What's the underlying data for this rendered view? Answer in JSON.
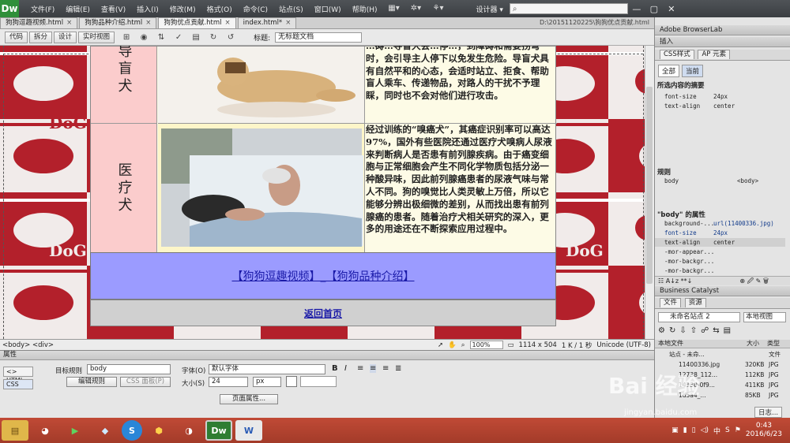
{
  "app": {
    "logo": "Dw",
    "designer_label": "设计器 ▾"
  },
  "menu": [
    "文件(F)",
    "编辑(E)",
    "查看(V)",
    "插入(I)",
    "修改(M)",
    "格式(O)",
    "命令(C)",
    "站点(S)",
    "窗口(W)",
    "帮助(H)"
  ],
  "tabs": [
    {
      "label": "狗狗逗趣视频.html",
      "active": false
    },
    {
      "label": "狗狗品种介绍.html",
      "active": false
    },
    {
      "label": "狗狗优点贡献.html",
      "active": true
    },
    {
      "label": "index.html*",
      "active": false
    }
  ],
  "doc_path": "D:\\20151120225\\狗狗优点贡献.html",
  "toolbar": {
    "code": "代码",
    "split": "拆分",
    "design": "设计",
    "live": "实时视图",
    "title_label": "标题:",
    "title_value": "无标题文档"
  },
  "page": {
    "row1": {
      "label": "导盲犬",
      "text": "…碍…导盲犬会…停…，到障碍和需要拐弯时，会引导主人停下以免发生危险。导盲犬具有自然平和的心态，会适时站立、拒食、帮助盲人乘车、传递物品，对路人的干扰不予理睬，同时也不会对他们进行攻击。"
    },
    "row2": {
      "label": "医疗犬",
      "text": "经过训练的“嗅癌犬”，其癌症识别率可以高达97%，国外有些医院还通过医疗犬嗅病人尿液来判断病人是否患有前列腺疾病。由于癌变细胞与正常细胞会产生不同化学物质包括分泌一种酸异味，因此前列腺癌患者的尿液气味与常人不同。狗的嗅觉比人类灵敏上万倍，所以它能够分辨出极细微的差别，从而找出患有前列腺癌的患者。随着治疗犬相关研究的深入，更多的用途还在不断探索应用过程中。"
    },
    "nav_links": "【狗狗逗趣视频】_【狗狗品种介绍】",
    "home_link": "返回首页",
    "pattern_text": "DoG"
  },
  "status": {
    "tags": "<body> <div>",
    "zoom": "100%",
    "size": "1114 x 504",
    "transfer": "1 K / 1 秒",
    "encoding": "Unicode (UTF-8)"
  },
  "props": {
    "header": "属性",
    "html_btn": "<> HTML",
    "css_btn": "CSS",
    "target_rule_label": "目标规则",
    "target_rule_value": "body",
    "edit_rule": "编辑规则",
    "css_panel": "CSS 面板(P)",
    "font_label": "字体(O)",
    "font_value": "默认字体",
    "size_label": "大小(S)",
    "size_value": "24",
    "unit_value": "px",
    "page_props": "页面属性..."
  },
  "panel": {
    "browserlab": "Adobe BrowserLab",
    "insert": "插入",
    "css_tab": "CSS样式",
    "ap_tab": "AP 元素",
    "all": "全部",
    "current": "当前",
    "summary_title": "所选内容的摘要",
    "summary": [
      {
        "k": "font-size",
        "v": "24px"
      },
      {
        "k": "text-align",
        "v": "center"
      }
    ],
    "rules_title": "规则",
    "rules": [
      {
        "k": "body",
        "v": "<body>"
      }
    ],
    "props_title": "\"body\" 的属性",
    "props": [
      {
        "k": "background-...",
        "v": "url(11400336.jpg)"
      },
      {
        "k": "font-size",
        "v": "24px"
      },
      {
        "k": "text-align",
        "v": "center"
      },
      {
        "k": "-mor-appear...",
        "v": ""
      },
      {
        "k": "-mor-backgr...",
        "v": ""
      },
      {
        "k": "-mor-backgr...",
        "v": ""
      }
    ],
    "bc_title": "Business Catalyst",
    "files_tab": "文件",
    "assets_tab": "资源",
    "site_select": "未命名站点 2",
    "view_select": "本地视图",
    "col_local": "本地文件",
    "col_size": "大小",
    "col_type": "类型",
    "files": [
      {
        "name": "站点 - 未命...",
        "size": "",
        "type": "文件"
      },
      {
        "name": "11400336.jpg",
        "size": "320KB",
        "type": "JPG"
      },
      {
        "name": "12738_112...",
        "size": "112KB",
        "type": "JPG"
      },
      {
        "name": "14130-0f9...",
        "size": "411KB",
        "type": "JPG"
      },
      {
        "name": "1d5a4_...",
        "size": "85KB",
        "type": "JPG"
      }
    ],
    "log": "日志..."
  },
  "taskbar": {
    "time": "0:43",
    "date": "2016/6/23",
    "lang": "中"
  },
  "watermark": {
    "main": "Bai 经验",
    "sub": "jingyan.baidu.com"
  }
}
